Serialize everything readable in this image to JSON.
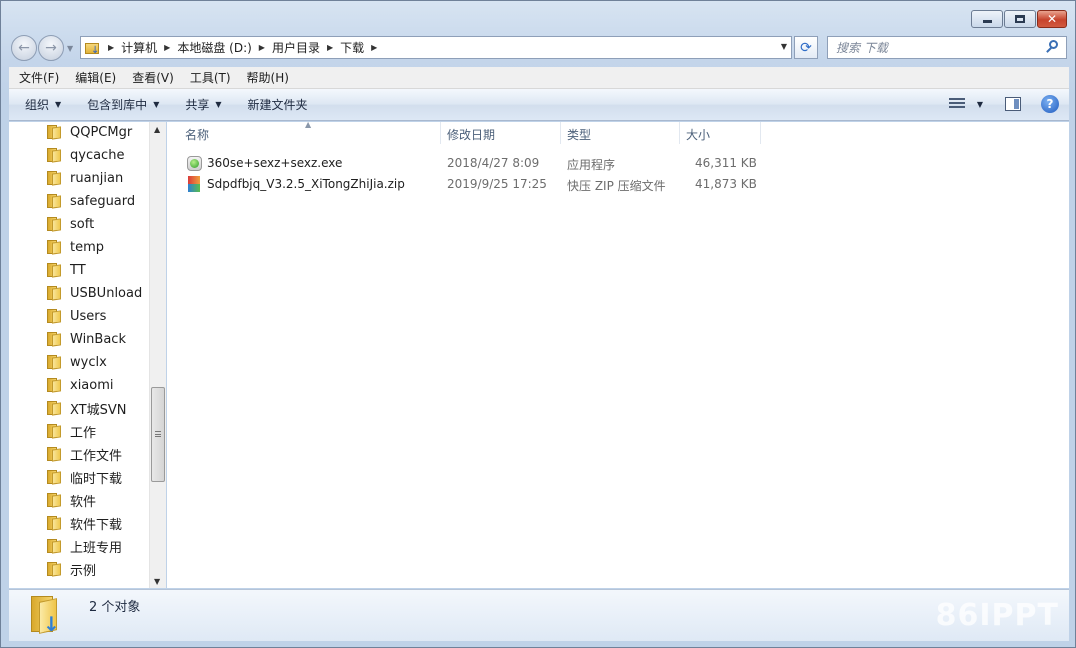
{
  "window": {
    "minimize_glyph": "—",
    "close_glyph": "✕"
  },
  "nav": {
    "back_glyph": "←",
    "forward_glyph": "→",
    "breadcrumbs": [
      "计算机",
      "本地磁盘 (D:)",
      "用户目录",
      "下载"
    ],
    "search_placeholder": "搜索 下载"
  },
  "menubar": {
    "items": [
      "文件(F)",
      "编辑(E)",
      "查看(V)",
      "工具(T)",
      "帮助(H)"
    ]
  },
  "toolbar": {
    "organize": "组织",
    "include_in_library": "包含到库中",
    "share": "共享",
    "new_folder": "新建文件夹",
    "help_glyph": "?"
  },
  "sidebar": {
    "items": [
      "QQPCMgr",
      "qycache",
      "ruanjian",
      "safeguard",
      "soft",
      "temp",
      "TT",
      "USBUnload",
      "Users",
      "WinBack",
      "wyclx",
      "xiaomi",
      "XT城SVN",
      "工作",
      "工作文件",
      "临时下载",
      "软件",
      "软件下载",
      "上班专用",
      "示例"
    ]
  },
  "columns": {
    "name": "名称",
    "date": "修改日期",
    "type": "类型",
    "size": "大小"
  },
  "files": [
    {
      "name": "360se+sexz+sexz.exe",
      "date": "2018/4/27 8:09",
      "type": "应用程序",
      "size": "46,311 KB",
      "icon": "exe-icon"
    },
    {
      "name": "Sdpdfbjq_V3.2.5_XiTongZhiJia.zip",
      "date": "2019/9/25 17:25",
      "type": "快压 ZIP 压缩文件",
      "size": "41,873 KB",
      "icon": "zip-icon"
    }
  ],
  "status": {
    "item_count": "2 个对象",
    "watermark": "86IPPT"
  }
}
